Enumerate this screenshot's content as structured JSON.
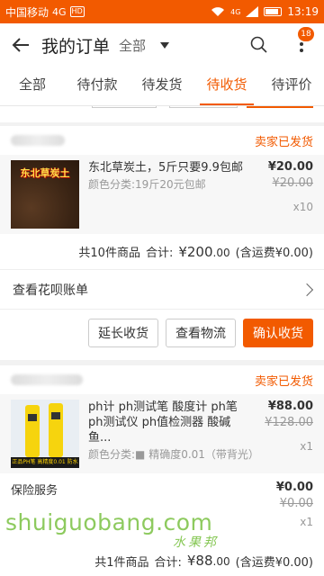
{
  "status_bar": {
    "carrier": "中国移动",
    "network": "4G",
    "hd": "HD",
    "signal_net": "4G",
    "time": "13:19"
  },
  "header": {
    "title": "我的订单",
    "filter_label": "全部",
    "badge_count": "18"
  },
  "tabs": [
    {
      "label": "全部"
    },
    {
      "label": "待付款"
    },
    {
      "label": "待发货"
    },
    {
      "label": "待收货",
      "active": true
    },
    {
      "label": "待评价"
    }
  ],
  "orders": [
    {
      "status": "卖家已发货",
      "item": {
        "thumb_text": "东北草炭土",
        "title": "东北草炭土，5斤只要9.9包邮",
        "spec": "颜色分类:19斤20元包邮",
        "price": "¥20.00",
        "original_price": "¥20.00",
        "qty": "x10"
      },
      "total": {
        "count_text": "共10件商品",
        "sum_label": "合计:",
        "sum_main": "¥200",
        "sum_decimal": ".00",
        "shipping": "(含运费¥0.00)"
      },
      "link_label": "查看花呗账单",
      "buttons": {
        "extend": "延长收货",
        "logistics": "查看物流",
        "confirm": "确认收货"
      }
    },
    {
      "status": "卖家已发货",
      "item": {
        "thumb_text": "正品PH笔 高精度0.01 防水",
        "title": "ph计 ph测试笔 酸度计 ph笔 ph测试仪 ph值检测器 酸碱 鱼...",
        "spec": "颜色分类:■ 精确度0.01（带背光）",
        "price": "¥88.00",
        "original_price": "¥128.00",
        "qty": "x1"
      },
      "service": {
        "name": "保险服务",
        "price": "¥0.00",
        "original_price": "¥0.00",
        "qty": "x1"
      },
      "total": {
        "count_text": "共1件商品",
        "sum_label": "合计:",
        "sum_main": "¥88",
        "sum_decimal": ".00",
        "shipping": "(含运费¥0.00)"
      }
    }
  ],
  "watermark": {
    "latin": "shuiguobang.com",
    "chinese": "水果邦"
  },
  "colors": {
    "accent": "#f25a00",
    "watermark": "#7ac143"
  }
}
